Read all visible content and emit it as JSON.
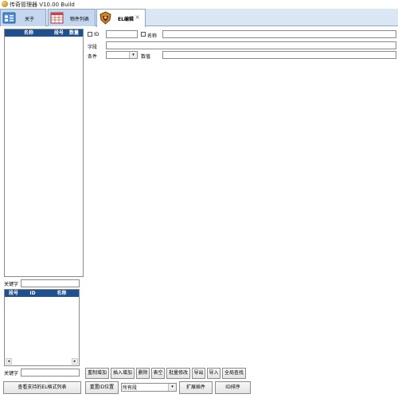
{
  "window": {
    "title": "传奇管理器 V10.00 Build"
  },
  "tabs": [
    {
      "label": "关于"
    },
    {
      "label": "物件列表"
    },
    {
      "label": "EL编辑",
      "close": "×"
    }
  ],
  "left_panel": {
    "top_list": {
      "columns": [
        "名称",
        "段号",
        "数量"
      ]
    },
    "keyword_label_1": "关键字",
    "keyword_value_1": "",
    "bottom_list": {
      "columns": [
        "段号",
        "ID",
        "名称"
      ]
    },
    "keyword_label_2": "关键字",
    "keyword_value_2": ""
  },
  "filters": {
    "id_label": "ID",
    "id_value": "",
    "name_label": "名称",
    "name_value": "",
    "field_label": "字段",
    "field_value": "",
    "condition_label": "条件",
    "condition_value": "",
    "number_label": "数值",
    "number_value": ""
  },
  "action_buttons": [
    "重制增加",
    "插入增加",
    "删除",
    "表空",
    "批量修改",
    "导出",
    "导入",
    "全局查找"
  ],
  "bottom_bar": {
    "view_list_button": "查看支持的EL格式列表",
    "reset_position_button": "重置ID位置",
    "segment_select": "所有段",
    "expand_button": "扩展插件",
    "sort_button": "ID排序"
  },
  "colors": {
    "header_bg": "#1f4f8c",
    "tab_bg": "#c5d7ef",
    "frame": "#8fa6c9"
  },
  "icons": {
    "app": "gold-coin-icon",
    "tab_about": "info-card-icon",
    "tab_items": "grid-table-icon",
    "tab_el": "crest-icon",
    "close": "close-icon"
  }
}
